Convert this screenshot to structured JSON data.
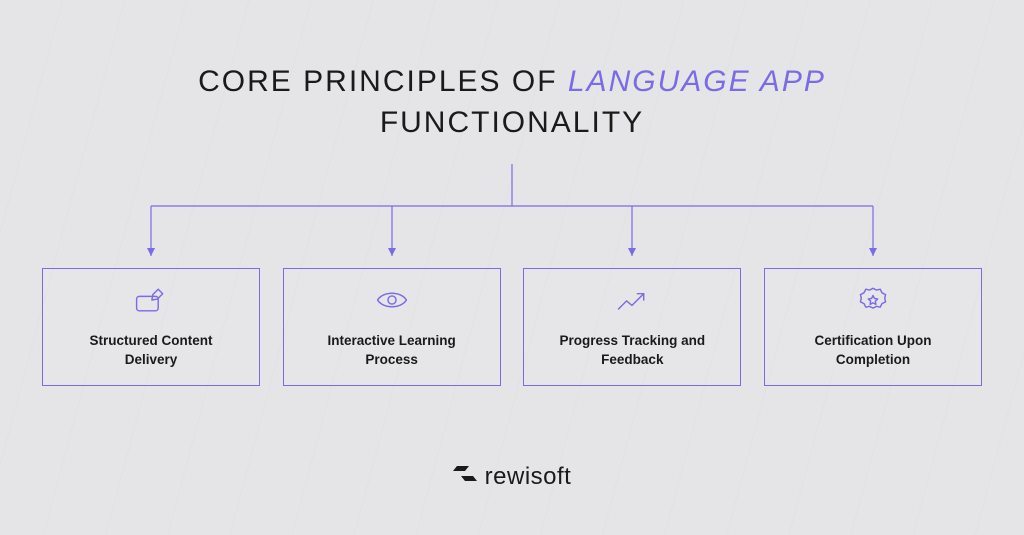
{
  "title": {
    "prefix": "CORE PRINCIPLES OF ",
    "emphasis": "LANGUAGE APP",
    "suffix": "FUNCTIONALITY"
  },
  "colors": {
    "accent": "#7a6be6",
    "text": "#1a1a1a",
    "bg": "#e5e5e7"
  },
  "boxes": [
    {
      "icon": "edit-card-icon",
      "label": "Structured Content Delivery"
    },
    {
      "icon": "eye-icon",
      "label": "Interactive Learning Process"
    },
    {
      "icon": "trend-up-icon",
      "label": "Progress Tracking and Feedback"
    },
    {
      "icon": "badge-star-icon",
      "label": "Certification Upon Completion"
    }
  ],
  "footer": {
    "brand": "rewisoft"
  }
}
